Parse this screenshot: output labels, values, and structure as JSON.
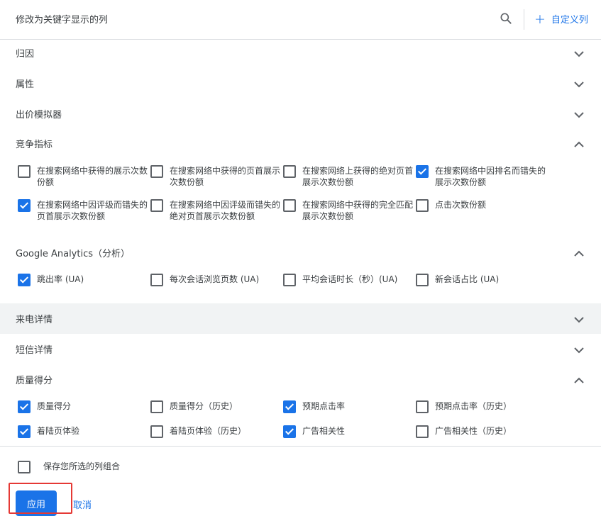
{
  "header": {
    "title": "修改为关键字显示的列",
    "search_icon": "search-icon",
    "custom_column_label": "自定义列"
  },
  "sections": [
    {
      "title": "归因",
      "expanded": false
    },
    {
      "title": "属性",
      "expanded": false
    },
    {
      "title": "出价模拟器",
      "expanded": false
    },
    {
      "title": "竞争指标",
      "expanded": true,
      "items": [
        {
          "label": "在搜索网络中获得的展示次数份额",
          "checked": false
        },
        {
          "label": "在搜索网络中获得的页首展示次数份额",
          "checked": false
        },
        {
          "label": "在搜索网络上获得的绝对页首展示次数份额",
          "checked": false
        },
        {
          "label": "在搜索网络中因排名而错失的展示次数份额",
          "checked": true
        },
        {
          "label": "在搜索网络中因评级而错失的页首展示次数份额",
          "checked": true
        },
        {
          "label": "在搜索网络中因评级而错失的绝对页首展示次数份额",
          "checked": false
        },
        {
          "label": "在搜索网络中获得的完全匹配展示次数份额",
          "checked": false
        },
        {
          "label": "点击次数份额",
          "checked": false
        }
      ]
    },
    {
      "title": "Google Analytics（分析）",
      "expanded": true,
      "items": [
        {
          "label": "跳出率 (UA)",
          "checked": true
        },
        {
          "label": "每次会话浏览页数 (UA)",
          "checked": false
        },
        {
          "label": "平均会话时长（秒）(UA)",
          "checked": false
        },
        {
          "label": "新会话占比 (UA)",
          "checked": false
        }
      ]
    },
    {
      "title": "来电详情",
      "expanded": false
    },
    {
      "title": "短信详情",
      "expanded": false
    },
    {
      "title": "质量得分",
      "expanded": true,
      "items": [
        {
          "label": "质量得分",
          "checked": true
        },
        {
          "label": "质量得分（历史）",
          "checked": false
        },
        {
          "label": "预期点击率",
          "checked": true
        },
        {
          "label": "预期点击率（历史）",
          "checked": false
        },
        {
          "label": "着陆页体验",
          "checked": true
        },
        {
          "label": "着陆页体验（历史）",
          "checked": false
        },
        {
          "label": "广告相关性",
          "checked": true
        },
        {
          "label": "广告相关性（历史）",
          "checked": false
        }
      ]
    }
  ],
  "footer": {
    "save_combo_label": "保存您所选的列组合",
    "save_combo_checked": false,
    "apply_label": "应用",
    "cancel_label": "取消"
  },
  "colors": {
    "accent": "#1a73e8",
    "highlight": "#e53935",
    "section_hover": "#f1f3f4"
  }
}
